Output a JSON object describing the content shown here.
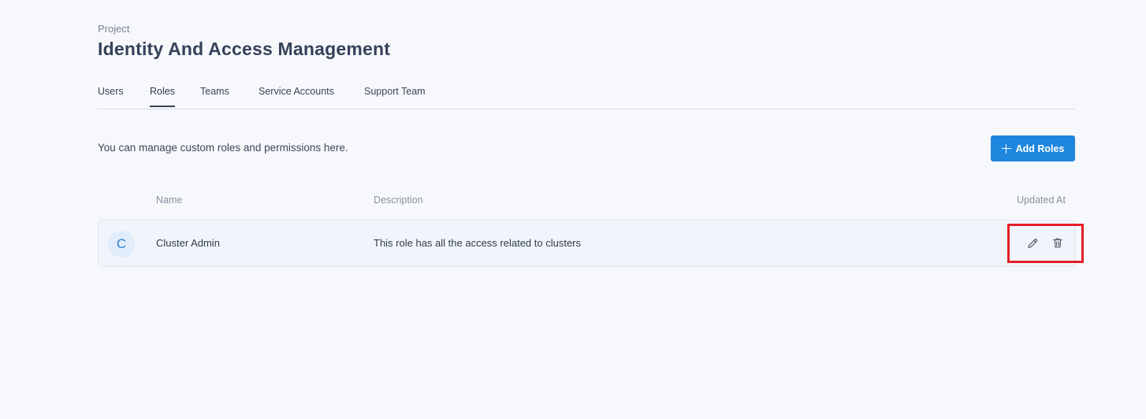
{
  "header": {
    "eyebrow": "Project",
    "title": "Identity And Access Management"
  },
  "tabs": [
    {
      "label": "Users"
    },
    {
      "label": "Roles",
      "active": true
    },
    {
      "label": "Teams"
    },
    {
      "label": "Service Accounts"
    },
    {
      "label": "Support Team"
    }
  ],
  "roles_section": {
    "description": "You can manage custom roles and permissions here.",
    "add_button_label": "Add Roles"
  },
  "table": {
    "columns": [
      "Name",
      "Description",
      "Updated At"
    ],
    "rows": [
      {
        "avatar_letter": "C",
        "name": "Cluster Admin",
        "description": "This role has all the access related to clusters"
      }
    ]
  },
  "icons": {
    "add": "plus-icon",
    "edit": "pencil-icon",
    "delete": "trash-icon"
  },
  "colors": {
    "background": "#f7f8fc",
    "primary": "#1f86de",
    "highlight": "#e21f26"
  }
}
